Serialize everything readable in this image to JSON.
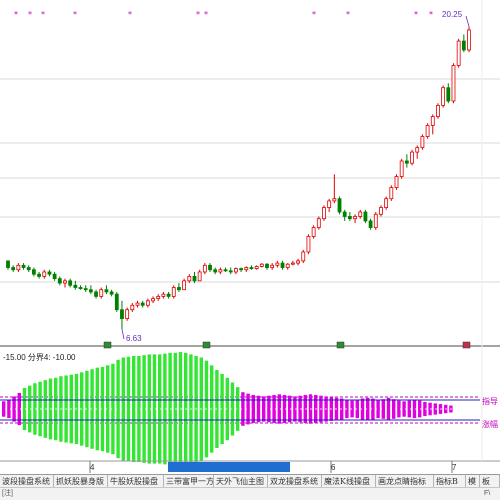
{
  "chart_data": {
    "type": "candlestick",
    "main": {
      "high_label": "20.25",
      "low_label": "6.63",
      "top_signal_marks": "*",
      "candles": [
        [
          9.7,
          9.7,
          9.3,
          9.4
        ],
        [
          9.4,
          9.5,
          9.2,
          9.3
        ],
        [
          9.3,
          9.6,
          9.2,
          9.5
        ],
        [
          9.5,
          9.6,
          9.3,
          9.4
        ],
        [
          9.4,
          9.5,
          9.2,
          9.3
        ],
        [
          9.3,
          9.4,
          9.0,
          9.1
        ],
        [
          9.1,
          9.2,
          8.9,
          9.0
        ],
        [
          9.0,
          9.3,
          8.9,
          9.2
        ],
        [
          9.2,
          9.3,
          9.0,
          9.1
        ],
        [
          9.1,
          9.2,
          8.8,
          8.9
        ],
        [
          8.9,
          9.0,
          8.6,
          8.7
        ],
        [
          8.7,
          8.9,
          8.5,
          8.8
        ],
        [
          8.8,
          8.9,
          8.5,
          8.6
        ],
        [
          8.6,
          8.8,
          8.4,
          8.5
        ],
        [
          8.5,
          8.6,
          8.4,
          8.45
        ],
        [
          8.45,
          8.6,
          8.3,
          8.4
        ],
        [
          8.4,
          8.6,
          8.2,
          8.3
        ],
        [
          8.3,
          8.4,
          8.0,
          8.1
        ],
        [
          8.1,
          8.5,
          8.0,
          8.4
        ],
        [
          8.4,
          8.6,
          8.2,
          8.3
        ],
        [
          8.3,
          8.4,
          8.1,
          8.2
        ],
        [
          8.2,
          8.3,
          7.4,
          7.5
        ],
        [
          7.5,
          7.9,
          6.63,
          7.1
        ],
        [
          7.1,
          7.6,
          7.0,
          7.5
        ],
        [
          7.5,
          7.8,
          7.4,
          7.7
        ],
        [
          7.7,
          7.9,
          7.6,
          7.8
        ],
        [
          7.8,
          7.9,
          7.6,
          7.7
        ],
        [
          7.7,
          8.0,
          7.6,
          7.9
        ],
        [
          7.9,
          8.1,
          7.8,
          8.0
        ],
        [
          8.0,
          8.2,
          7.9,
          8.1
        ],
        [
          8.1,
          8.3,
          8.0,
          8.2
        ],
        [
          8.2,
          8.3,
          8.0,
          8.1
        ],
        [
          8.1,
          8.6,
          8.0,
          8.5
        ],
        [
          8.5,
          8.7,
          8.3,
          8.4
        ],
        [
          8.4,
          8.9,
          8.4,
          8.8
        ],
        [
          8.8,
          9.1,
          8.7,
          9.0
        ],
        [
          9.0,
          9.2,
          8.7,
          8.8
        ],
        [
          8.8,
          9.3,
          8.8,
          9.2
        ],
        [
          9.2,
          9.6,
          9.1,
          9.5
        ],
        [
          9.5,
          9.6,
          9.2,
          9.3
        ],
        [
          9.3,
          9.4,
          9.1,
          9.2
        ],
        [
          9.2,
          9.4,
          9.1,
          9.3
        ],
        [
          9.3,
          9.4,
          9.2,
          9.25
        ],
        [
          9.25,
          9.4,
          9.1,
          9.2
        ],
        [
          9.2,
          9.4,
          9.1,
          9.35
        ],
        [
          9.35,
          9.4,
          9.2,
          9.3
        ],
        [
          9.3,
          9.45,
          9.2,
          9.4
        ],
        [
          9.4,
          9.5,
          9.3,
          9.35
        ],
        [
          9.35,
          9.5,
          9.3,
          9.45
        ],
        [
          9.45,
          9.6,
          9.4,
          9.55
        ],
        [
          9.55,
          9.6,
          9.3,
          9.4
        ],
        [
          9.4,
          9.6,
          9.3,
          9.5
        ],
        [
          9.5,
          9.7,
          9.4,
          9.6
        ],
        [
          9.6,
          9.7,
          9.3,
          9.4
        ],
        [
          9.4,
          9.6,
          9.3,
          9.55
        ],
        [
          9.55,
          9.7,
          9.5,
          9.6
        ],
        [
          9.6,
          9.8,
          9.5,
          9.7
        ],
        [
          9.7,
          10.2,
          9.6,
          10.1
        ],
        [
          10.1,
          10.9,
          10.0,
          10.8
        ],
        [
          10.8,
          11.3,
          10.7,
          11.2
        ],
        [
          11.2,
          11.7,
          11.1,
          11.6
        ],
        [
          11.6,
          12.2,
          11.5,
          12.1
        ],
        [
          12.1,
          12.5,
          11.9,
          12.4
        ],
        [
          12.4,
          13.6,
          12.3,
          12.5
        ],
        [
          12.5,
          12.6,
          11.8,
          11.9
        ],
        [
          11.9,
          12.0,
          11.5,
          11.7
        ],
        [
          11.7,
          11.9,
          11.5,
          11.6
        ],
        [
          11.6,
          11.8,
          11.4,
          11.7
        ],
        [
          11.7,
          12.0,
          11.6,
          11.9
        ],
        [
          11.9,
          12.0,
          11.4,
          11.5
        ],
        [
          11.5,
          11.6,
          11.1,
          11.2
        ],
        [
          11.2,
          11.9,
          11.1,
          11.8
        ],
        [
          11.8,
          12.2,
          11.7,
          12.1
        ],
        [
          12.1,
          12.6,
          12.0,
          12.5
        ],
        [
          12.5,
          13.1,
          12.4,
          13.0
        ],
        [
          13.0,
          13.6,
          12.9,
          13.5
        ],
        [
          13.5,
          14.3,
          13.4,
          14.2
        ],
        [
          14.2,
          14.5,
          13.9,
          14.1
        ],
        [
          14.1,
          14.7,
          14.0,
          14.6
        ],
        [
          14.6,
          14.9,
          14.3,
          14.8
        ],
        [
          14.8,
          15.4,
          14.7,
          15.3
        ],
        [
          15.3,
          15.9,
          15.2,
          15.8
        ],
        [
          15.8,
          16.3,
          15.4,
          16.2
        ],
        [
          16.2,
          16.8,
          16.1,
          16.7
        ],
        [
          16.7,
          17.6,
          16.6,
          17.5
        ],
        [
          17.5,
          17.7,
          16.8,
          16.9
        ],
        [
          16.9,
          18.6,
          16.8,
          18.5
        ],
        [
          18.5,
          19.7,
          18.4,
          19.6
        ],
        [
          19.6,
          19.9,
          19.1,
          19.2
        ],
        [
          19.2,
          20.25,
          19.1,
          20.1
        ]
      ]
    },
    "indicator": {
      "header": "-15.00 分界4: -10.00",
      "amplitudes": [
        1.1,
        1.3,
        1.8,
        2.3,
        2.7,
        3.0,
        3.3,
        3.5,
        3.7,
        3.9,
        4.0,
        4.2,
        4.3,
        4.4,
        4.5,
        4.7,
        4.9,
        5.1,
        5.3,
        5.4,
        5.6,
        5.8,
        6.3,
        6.6,
        6.7,
        6.8,
        6.8,
        6.9,
        7.0,
        7.0,
        7.0,
        7.1,
        7.2,
        7.2,
        7.3,
        7.2,
        7.0,
        6.8,
        6.6,
        6.2,
        5.6,
        5.0,
        4.5,
        4.0,
        3.4,
        2.8,
        2.4,
        2.2,
        2.0,
        1.9,
        1.8,
        1.9,
        2.0,
        2.1,
        2.0,
        1.9,
        1.8,
        1.9,
        2.0,
        2.1,
        2.0,
        1.9,
        1.8,
        1.7,
        1.6,
        1.5,
        1.3,
        1.2,
        1.3,
        1.5,
        1.6,
        1.5,
        1.3,
        1.4,
        1.6,
        1.4,
        1.2,
        1.1,
        1.2,
        1.3,
        1.2,
        1.0,
        0.9,
        0.8,
        0.7,
        0.6,
        0.5
      ],
      "right_labels": [
        "指导",
        "涨幅"
      ]
    },
    "time_axis": [
      "4",
      "6",
      "7"
    ]
  },
  "scroll": {
    "value": ""
  },
  "tabs": [
    "波段操盘系统",
    "抓妖股暴身版",
    "牛股妖股操盘",
    "三带富甲一方",
    "天外飞仙主图",
    "双龙操盘系统",
    "魔法K线操盘",
    "画龙点睛指标",
    "指标B",
    "模",
    "板"
  ],
  "bottom_bar": {
    "left": "[注]",
    "right": "F\\"
  },
  "colors": {
    "up": "#e00000",
    "down": "#008000",
    "grid": "#d8d8d8",
    "indicator_green": "#33e633",
    "indicator_magenta": "#e000e0"
  }
}
